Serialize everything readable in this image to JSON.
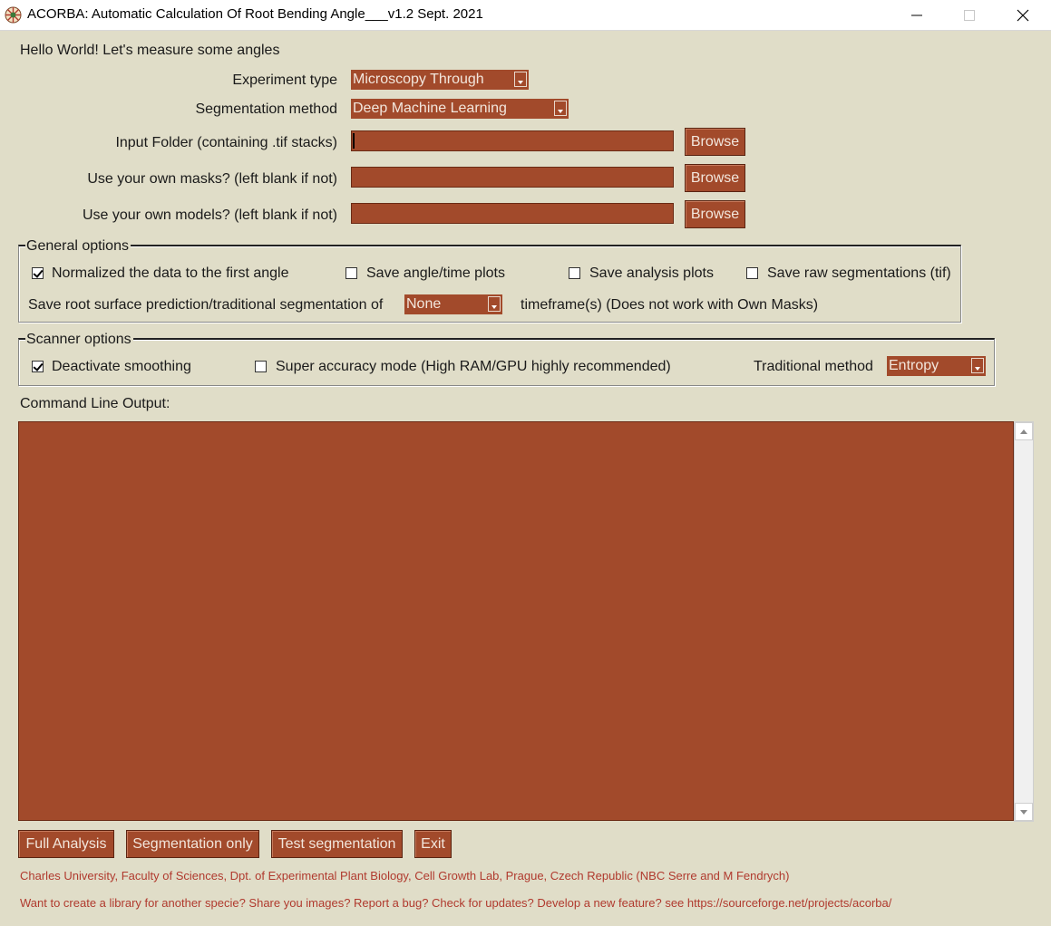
{
  "window": {
    "title": "ACORBA: Automatic Calculation Of Root Bending Angle___v1.2 Sept. 2021",
    "icon": "acorba-app-icon",
    "controls": [
      "minimize-icon",
      "maximize-icon",
      "close-icon"
    ]
  },
  "greeting": "Hello World! Let's measure some angles",
  "form": {
    "experiment_type_label": "Experiment type",
    "experiment_type_value": "Microscopy Through",
    "segmentation_method_label": "Segmentation method",
    "segmentation_method_value": "Deep Machine Learning",
    "input_folder_label": "Input Folder (containing .tif stacks)",
    "input_folder_value": "",
    "own_masks_label": "Use your own masks? (left blank if not)",
    "own_masks_value": "",
    "own_models_label": "Use your own models? (left blank if not)",
    "own_models_value": "",
    "browse_label": "Browse"
  },
  "general_options": {
    "title": "General options",
    "normalize_label": "Normalized the data to the first angle",
    "normalize_checked": true,
    "save_angle_time_label": "Save angle/time plots",
    "save_angle_time_checked": false,
    "save_analysis_label": "Save analysis plots",
    "save_analysis_checked": false,
    "save_raw_label": "Save raw segmentations (tif)",
    "save_raw_checked": false,
    "save_surface_label": "Save root surface prediction/traditional segmentation of",
    "save_surface_value": "None",
    "timeframe_note": "timeframe(s) (Does not work with Own Masks)"
  },
  "scanner_options": {
    "title": "Scanner options",
    "deactivate_smoothing_label": "Deactivate smoothing",
    "deactivate_smoothing_checked": true,
    "super_accuracy_label": "Super accuracy mode (High RAM/GPU highly recommended)",
    "super_accuracy_checked": false,
    "traditional_method_label": "Traditional method",
    "traditional_method_value": "Entropy"
  },
  "console": {
    "label": "Command Line Output:",
    "text": ""
  },
  "actions": {
    "full_analysis": "Full Analysis",
    "segmentation_only": "Segmentation only",
    "test_segmentation": "Test segmentation",
    "exit": "Exit"
  },
  "footer": {
    "credits": "Charles University, Faculty of Sciences, Dpt. of Experimental Plant Biology, Cell Growth Lab, Prague, Czech Republic (NBC Serre and M Fendrych)",
    "info": "Want to create a library for another specie? Share you images? Report a bug? Check for updates? Develop a new  feature? see https://sourceforge.net/projects/acorba/"
  },
  "colors": {
    "background": "#e0ddc8",
    "widget": "#a24a2b",
    "widget_text": "#f2e6dc",
    "footer_text": "#b03a2e"
  }
}
